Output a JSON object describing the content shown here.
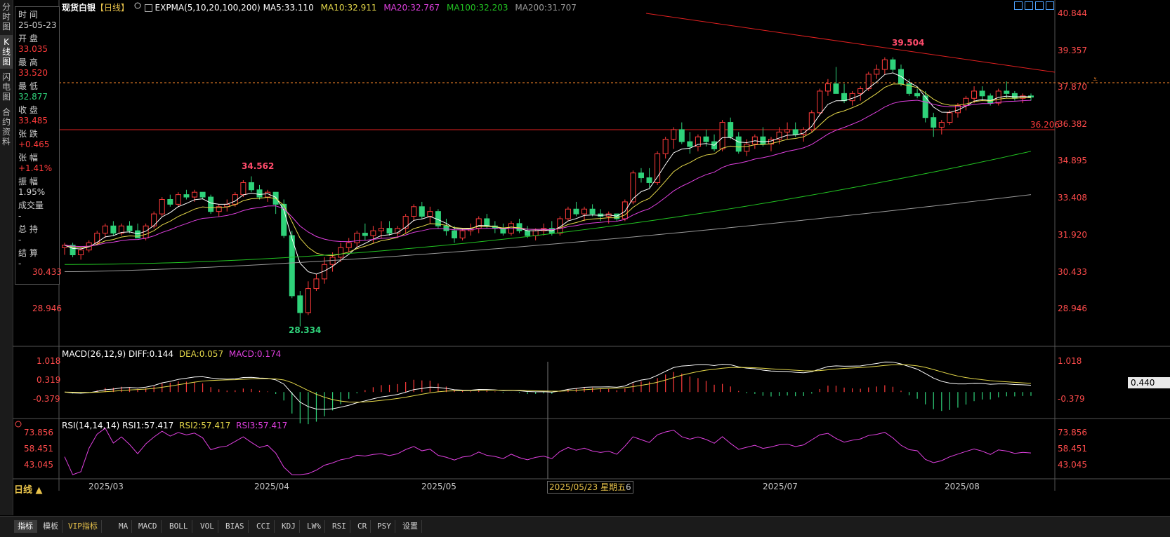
{
  "window": {
    "title": "现货白银",
    "period": "【日线】"
  },
  "left_tabs": [
    {
      "label": "分时图"
    },
    {
      "label": "K线图"
    },
    {
      "label": "闪电图"
    },
    {
      "label": "合约资料"
    }
  ],
  "info_panel": {
    "time_label": "时 间",
    "time_value": "25-05-23",
    "open_label": "开 盘",
    "open_value": "33.035",
    "high_label": "最 高",
    "high_value": "33.520",
    "low_label": "最 低",
    "low_value": "32.877",
    "close_label": "收 盘",
    "close_value": "33.485",
    "change_label": "张 跌",
    "change_value": "+0.465",
    "pct_label": "张 幅",
    "pct_value": "+1.41%",
    "amp_label": "振 幅",
    "amp_value": "1.95%",
    "vol_label": "成交量",
    "vol_value": "-",
    "oi_label": "总 持",
    "oi_value": "-",
    "settle_label": "结 算",
    "settle_value": "-"
  },
  "main_legend": {
    "indicator": "EXPMA(5,10,20,100,200)",
    "ma5": "MA5:33.110",
    "ma10": "MA10:32.911",
    "ma20": "MA20:32.767",
    "ma100": "MA100:32.203",
    "ma200": "MA200:31.707"
  },
  "macd_legend": {
    "name": "MACD(26,12,9)",
    "diff": "DIFF:0.144",
    "dea": "DEA:0.057",
    "macd": "MACD:0.174"
  },
  "rsi_legend": {
    "name": "RSI(14,14,14)",
    "rsi1": "RSI1:57.417",
    "rsi2": "RSI2:57.417",
    "rsi3": "RSI3:57.417"
  },
  "price_axis": [
    "40.844",
    "39.357",
    "37.870",
    "36.382",
    "34.895",
    "33.408",
    "31.920",
    "30.433",
    "28.946"
  ],
  "left_price_axis": [
    "30.433",
    "28.946"
  ],
  "macd_axis": [
    "1.018",
    "0.319",
    "-0.379"
  ],
  "macd_current": "0.440",
  "rsi_axis": [
    "73.856",
    "58.451",
    "43.045"
  ],
  "annotations": {
    "high": "39.504",
    "high2": "34.562",
    "low": "28.334",
    "hline": "36.206"
  },
  "x_axis": [
    "2025/03",
    "2025/04",
    "2025/05",
    "2025/07",
    "2025/08"
  ],
  "cursor_label": "2025/05/23 星期五",
  "cursor_tail": "6",
  "period_button": "日线 ▲",
  "bottom_tabs": [
    "指标",
    "模板",
    "VIP指标",
    "MA",
    "MACD",
    "BOLL",
    "VOL",
    "BIAS",
    "CCI",
    "KDJ",
    "LW%",
    "RSI",
    "CR",
    "PSY",
    "设置"
  ],
  "colors": {
    "up": "#ff3b3b",
    "down": "#2fd27a",
    "ma5": "#ffffff",
    "ma10": "#e6d94a",
    "ma20": "#e040e0",
    "ma100": "#22c422",
    "ma200": "#9a9a9a"
  },
  "chart_data": {
    "type": "candlestick",
    "price_range": [
      28.2,
      41.3
    ],
    "macd_range": [
      -0.75,
      1.2
    ],
    "rsi_range": [
      30,
      82
    ],
    "ohlc": [
      [
        31.6,
        31.8,
        31.3,
        31.7
      ],
      [
        31.7,
        31.8,
        31.2,
        31.3
      ],
      [
        31.3,
        31.6,
        31.1,
        31.5
      ],
      [
        31.5,
        31.9,
        31.4,
        31.8
      ],
      [
        31.8,
        32.3,
        31.7,
        32.2
      ],
      [
        32.2,
        32.6,
        32.0,
        32.5
      ],
      [
        32.5,
        32.7,
        32.1,
        32.2
      ],
      [
        32.2,
        32.6,
        32.1,
        32.5
      ],
      [
        32.5,
        32.7,
        32.2,
        32.3
      ],
      [
        32.3,
        32.6,
        32.0,
        32.0
      ],
      [
        32.0,
        32.6,
        31.9,
        32.5
      ],
      [
        32.5,
        33.1,
        32.4,
        33.0
      ],
      [
        33.0,
        33.7,
        32.9,
        33.6
      ],
      [
        33.6,
        33.8,
        33.3,
        33.4
      ],
      [
        33.4,
        33.9,
        33.3,
        33.8
      ],
      [
        33.8,
        34.0,
        33.6,
        33.7
      ],
      [
        33.7,
        34.0,
        33.5,
        33.9
      ],
      [
        33.9,
        33.9,
        33.6,
        33.7
      ],
      [
        33.7,
        33.8,
        33.0,
        33.1
      ],
      [
        33.1,
        33.4,
        32.9,
        33.3
      ],
      [
        33.3,
        33.6,
        33.1,
        33.4
      ],
      [
        33.4,
        33.9,
        33.3,
        33.8
      ],
      [
        33.8,
        34.4,
        33.7,
        34.3
      ],
      [
        34.3,
        34.56,
        33.9,
        34.0
      ],
      [
        34.0,
        34.2,
        33.6,
        33.7
      ],
      [
        33.7,
        34.0,
        33.5,
        33.9
      ],
      [
        33.9,
        33.9,
        33.0,
        33.4
      ],
      [
        33.4,
        33.6,
        32.0,
        32.1
      ],
      [
        32.1,
        32.3,
        29.5,
        29.6
      ],
      [
        29.6,
        29.8,
        28.33,
        28.9
      ],
      [
        28.9,
        30.2,
        28.8,
        29.9
      ],
      [
        29.9,
        30.5,
        29.8,
        30.3
      ],
      [
        30.3,
        31.2,
        30.1,
        30.9
      ],
      [
        30.9,
        31.4,
        30.6,
        31.2
      ],
      [
        31.2,
        31.8,
        31.0,
        31.6
      ],
      [
        31.6,
        32.0,
        31.4,
        31.8
      ],
      [
        31.8,
        32.3,
        31.6,
        32.2
      ],
      [
        32.2,
        32.6,
        31.9,
        32.1
      ],
      [
        32.1,
        32.5,
        31.8,
        32.3
      ],
      [
        32.3,
        32.7,
        32.0,
        32.4
      ],
      [
        32.4,
        32.7,
        32.1,
        32.2
      ],
      [
        32.2,
        32.5,
        32.0,
        32.4
      ],
      [
        32.4,
        33.0,
        32.2,
        32.9
      ],
      [
        32.9,
        33.4,
        32.7,
        33.3
      ],
      [
        33.3,
        33.5,
        32.8,
        32.9
      ],
      [
        32.9,
        33.3,
        32.6,
        33.1
      ],
      [
        33.1,
        33.2,
        32.4,
        32.5
      ],
      [
        32.5,
        32.8,
        32.1,
        32.3
      ],
      [
        32.3,
        32.5,
        31.8,
        32.0
      ],
      [
        32.0,
        32.4,
        31.9,
        32.3
      ],
      [
        32.3,
        32.6,
        32.1,
        32.4
      ],
      [
        32.4,
        32.9,
        32.2,
        32.8
      ],
      [
        32.8,
        33.0,
        32.4,
        32.5
      ],
      [
        32.5,
        32.7,
        32.2,
        32.4
      ],
      [
        32.4,
        32.6,
        32.1,
        32.2
      ],
      [
        32.2,
        32.7,
        32.1,
        32.6
      ],
      [
        32.6,
        32.8,
        32.2,
        32.3
      ],
      [
        32.3,
        32.5,
        32.0,
        32.1
      ],
      [
        32.1,
        32.4,
        31.9,
        32.3
      ],
      [
        32.3,
        32.6,
        32.1,
        32.4
      ],
      [
        32.4,
        32.7,
        32.1,
        32.2
      ],
      [
        32.2,
        32.9,
        32.1,
        32.8
      ],
      [
        32.8,
        33.3,
        32.7,
        33.2
      ],
      [
        33.2,
        33.5,
        32.9,
        33.0
      ],
      [
        33.0,
        33.3,
        32.7,
        33.2
      ],
      [
        33.2,
        33.4,
        32.9,
        33.0
      ],
      [
        33.0,
        33.2,
        32.7,
        32.9
      ],
      [
        32.9,
        33.1,
        32.6,
        33.0
      ],
      [
        33.0,
        33.0,
        32.7,
        32.8
      ],
      [
        32.8,
        33.6,
        32.7,
        33.5
      ],
      [
        33.5,
        34.8,
        33.4,
        34.7
      ],
      [
        34.7,
        34.9,
        34.3,
        34.5
      ],
      [
        34.5,
        34.9,
        34.1,
        34.3
      ],
      [
        34.3,
        35.6,
        34.2,
        35.5
      ],
      [
        35.5,
        36.2,
        35.3,
        36.1
      ],
      [
        36.1,
        36.6,
        35.7,
        36.5
      ],
      [
        36.5,
        36.8,
        35.9,
        36.0
      ],
      [
        36.0,
        36.4,
        35.5,
        35.8
      ],
      [
        35.8,
        36.3,
        35.6,
        36.2
      ],
      [
        36.2,
        36.5,
        35.8,
        36.0
      ],
      [
        36.0,
        36.3,
        35.6,
        35.7
      ],
      [
        35.7,
        36.9,
        35.6,
        36.8
      ],
      [
        36.8,
        37.0,
        36.1,
        36.2
      ],
      [
        36.2,
        36.4,
        35.5,
        35.6
      ],
      [
        35.6,
        36.1,
        35.4,
        35.9
      ],
      [
        35.9,
        36.3,
        35.7,
        36.2
      ],
      [
        36.2,
        36.6,
        35.8,
        35.9
      ],
      [
        35.9,
        36.2,
        35.6,
        36.1
      ],
      [
        36.1,
        36.6,
        35.9,
        36.4
      ],
      [
        36.4,
        36.8,
        36.1,
        36.5
      ],
      [
        36.5,
        36.8,
        36.2,
        36.3
      ],
      [
        36.3,
        36.6,
        36.0,
        36.5
      ],
      [
        36.5,
        37.3,
        36.4,
        37.2
      ],
      [
        37.2,
        38.2,
        37.1,
        38.1
      ],
      [
        38.1,
        38.6,
        37.9,
        38.4
      ],
      [
        38.4,
        39.1,
        38.2,
        38.0
      ],
      [
        38.0,
        38.4,
        37.6,
        37.7
      ],
      [
        37.7,
        38.1,
        37.5,
        38.0
      ],
      [
        38.0,
        38.3,
        37.7,
        38.2
      ],
      [
        38.2,
        38.9,
        38.1,
        38.8
      ],
      [
        38.8,
        39.2,
        38.6,
        39.0
      ],
      [
        39.0,
        39.5,
        38.8,
        39.4
      ],
      [
        39.4,
        39.5,
        38.9,
        39.0
      ],
      [
        39.0,
        39.2,
        38.3,
        38.4
      ],
      [
        38.4,
        38.6,
        37.9,
        38.0
      ],
      [
        38.0,
        38.2,
        37.8,
        37.9
      ],
      [
        37.9,
        38.1,
        36.8,
        37.0
      ],
      [
        37.0,
        37.2,
        36.2,
        36.6
      ],
      [
        36.6,
        36.9,
        36.3,
        36.8
      ],
      [
        36.8,
        37.3,
        36.7,
        37.2
      ],
      [
        37.2,
        37.6,
        37.0,
        37.5
      ],
      [
        37.5,
        37.9,
        37.3,
        37.8
      ],
      [
        37.8,
        38.3,
        37.6,
        38.1
      ],
      [
        38.1,
        38.3,
        37.7,
        37.9
      ],
      [
        37.9,
        38.0,
        37.5,
        37.6
      ],
      [
        37.6,
        38.2,
        37.5,
        38.1
      ],
      [
        38.1,
        38.5,
        37.8,
        38.0
      ],
      [
        38.0,
        38.1,
        37.7,
        37.8
      ],
      [
        37.8,
        38.0,
        37.6,
        37.9
      ],
      [
        37.9,
        38.0,
        37.7,
        37.85
      ]
    ]
  }
}
